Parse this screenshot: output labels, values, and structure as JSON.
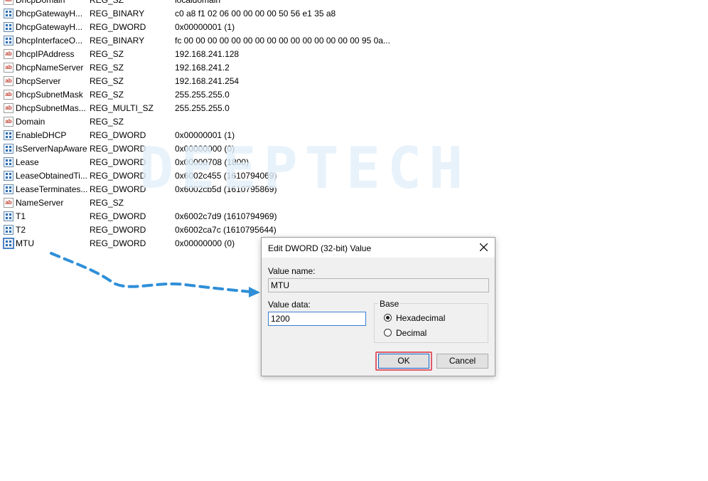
{
  "registry": {
    "rows": [
      {
        "name": "DhcpDomain",
        "type": "REG_SZ",
        "data": "localdomain",
        "icon": "string-icon"
      },
      {
        "name": "DhcpGatewayH...",
        "type": "REG_BINARY",
        "data": "c0 a8 f1 02 06 00 00 00 00 50 56 e1 35 a8",
        "icon": "binary-icon"
      },
      {
        "name": "DhcpGatewayH...",
        "type": "REG_DWORD",
        "data": "0x00000001 (1)",
        "icon": "binary-icon"
      },
      {
        "name": "DhcpInterfaceO...",
        "type": "REG_BINARY",
        "data": "fc 00 00 00 00 00 00 00 00 00 00 00 00 00 00 00 95 0a...",
        "icon": "binary-icon"
      },
      {
        "name": "DhcpIPAddress",
        "type": "REG_SZ",
        "data": "192.168.241.128",
        "icon": "string-icon"
      },
      {
        "name": "DhcpNameServer",
        "type": "REG_SZ",
        "data": "192.168.241.2",
        "icon": "string-icon"
      },
      {
        "name": "DhcpServer",
        "type": "REG_SZ",
        "data": "192.168.241.254",
        "icon": "string-icon"
      },
      {
        "name": "DhcpSubnetMask",
        "type": "REG_SZ",
        "data": "255.255.255.0",
        "icon": "string-icon"
      },
      {
        "name": "DhcpSubnetMas...",
        "type": "REG_MULTI_SZ",
        "data": "255.255.255.0",
        "icon": "string-icon"
      },
      {
        "name": "Domain",
        "type": "REG_SZ",
        "data": "",
        "icon": "string-icon"
      },
      {
        "name": "EnableDHCP",
        "type": "REG_DWORD",
        "data": "0x00000001 (1)",
        "icon": "binary-icon"
      },
      {
        "name": "IsServerNapAware",
        "type": "REG_DWORD",
        "data": "0x00000000 (0)",
        "icon": "binary-icon"
      },
      {
        "name": "Lease",
        "type": "REG_DWORD",
        "data": "0x00000708 (1800)",
        "icon": "binary-icon"
      },
      {
        "name": "LeaseObtainedTi...",
        "type": "REG_DWORD",
        "data": "0x6002c455 (1610794069)",
        "icon": "binary-icon"
      },
      {
        "name": "LeaseTerminates...",
        "type": "REG_DWORD",
        "data": "0x6002cb5d (1610795869)",
        "icon": "binary-icon"
      },
      {
        "name": "NameServer",
        "type": "REG_SZ",
        "data": "",
        "icon": "string-icon"
      },
      {
        "name": "T1",
        "type": "REG_DWORD",
        "data": "0x6002c7d9 (1610794969)",
        "icon": "binary-icon"
      },
      {
        "name": "T2",
        "type": "REG_DWORD",
        "data": "0x6002ca7c (1610795644)",
        "icon": "binary-icon"
      },
      {
        "name": "MTU",
        "type": "REG_DWORD",
        "data": "0x00000000 (0)",
        "icon": "binary-icon"
      }
    ],
    "string_icon_text": "ab"
  },
  "watermark": "DEEPTECH",
  "dialog": {
    "title": "Edit DWORD (32-bit) Value",
    "value_name_label": "Value name:",
    "value_name": "MTU",
    "value_data_label": "Value data:",
    "value_data": "1200",
    "base_label": "Base",
    "radio_hex_label": "Hexadecimal",
    "radio_dec_label": "Decimal",
    "ok_label": "OK",
    "cancel_label": "Cancel",
    "selected_base": "Hexadecimal"
  },
  "colors": {
    "arrow": "#2f8fd8",
    "highlight": "#e05a66",
    "watermark": "#e3f0fb"
  }
}
